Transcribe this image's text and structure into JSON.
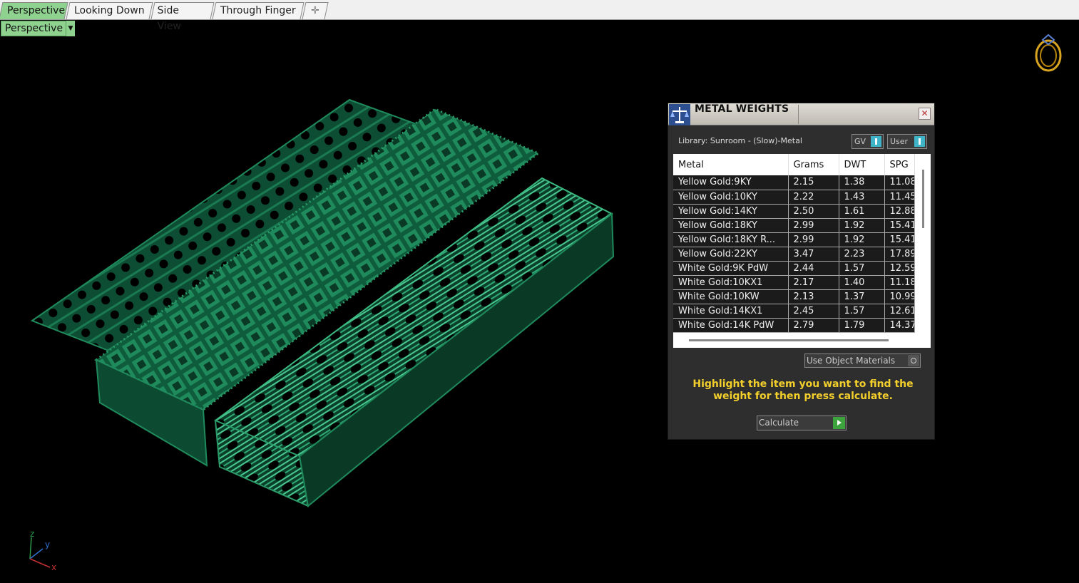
{
  "tabs": [
    {
      "label": "Perspective",
      "active": true
    },
    {
      "label": "Looking Down",
      "active": false
    },
    {
      "label": "Side View",
      "active": false
    },
    {
      "label": "Through Finger",
      "active": false
    }
  ],
  "viewport": {
    "label": "Perspective"
  },
  "panel": {
    "title": "METAL WEIGHTS",
    "library": "Library: Sunroom - (Slow)-Metal",
    "gv_label": "GV",
    "user_label": "User",
    "columns": [
      "Metal",
      "Grams",
      "DWT",
      "SPG"
    ],
    "rows": [
      [
        "Yellow Gold:9KY",
        "2.15",
        "1.38",
        "11.08"
      ],
      [
        "Yellow Gold:10KY",
        "2.22",
        "1.43",
        "11.45"
      ],
      [
        "Yellow Gold:14KY",
        "2.50",
        "1.61",
        "12.88"
      ],
      [
        "Yellow Gold:18KY",
        "2.99",
        "1.92",
        "15.41"
      ],
      [
        "Yellow Gold:18KY R...",
        "2.99",
        "1.92",
        "15.41"
      ],
      [
        "Yellow Gold:22KY",
        "3.47",
        "2.23",
        "17.89"
      ],
      [
        "White Gold:9K PdW",
        "2.44",
        "1.57",
        "12.59"
      ],
      [
        "White Gold:10KX1",
        "2.17",
        "1.40",
        "11.18"
      ],
      [
        "White Gold:10KW",
        "2.13",
        "1.37",
        "10.99"
      ],
      [
        "White Gold:14KX1",
        "2.45",
        "1.57",
        "12.61"
      ],
      [
        "White Gold:14K PdW",
        "2.79",
        "1.79",
        "14.37"
      ]
    ],
    "use_object_materials": "Use Object Materials",
    "hint": "Highlight the item you want to find the weight for then press calculate.",
    "calculate_label": "Calculate"
  },
  "axes": {
    "z": "z",
    "y": "y",
    "x": "x"
  },
  "colors": {
    "accent_green": "#8fd18f",
    "model_green": "#1f8a5c",
    "hint_yellow": "#f3cf2c"
  }
}
